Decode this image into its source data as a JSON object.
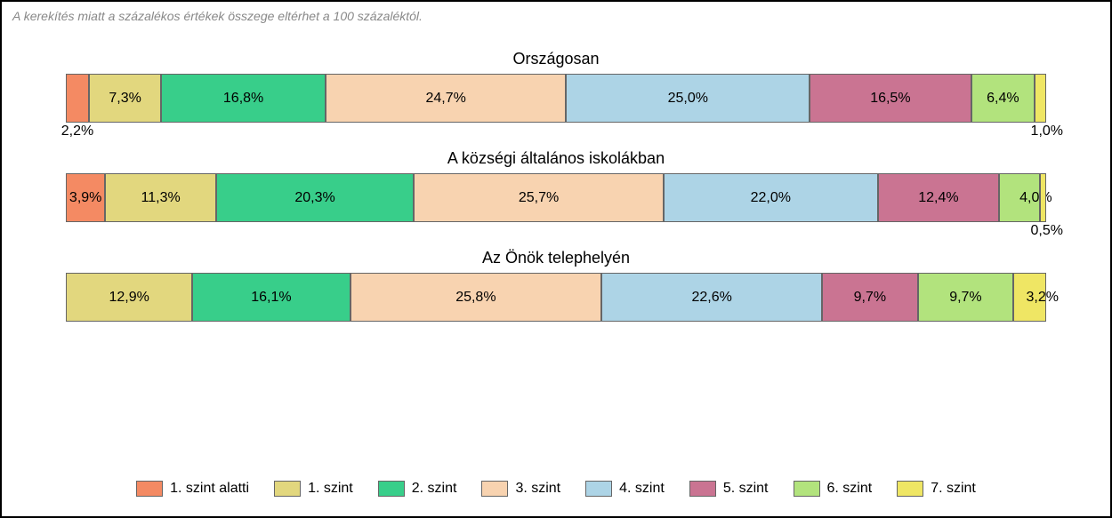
{
  "note": "A kerekítés miatt a százalékos értékek összege eltérhet a 100 százaléktól.",
  "chart_data": {
    "type": "bar",
    "stacked": true,
    "orientation": "horizontal",
    "categories": [
      "Országosan",
      "A községi általános iskolákban",
      "Az Önök telephelyén"
    ],
    "series": [
      {
        "name": "1. szint alatti",
        "color": "#f48a63",
        "values": [
          2.2,
          3.9,
          0.0
        ]
      },
      {
        "name": "1. szint",
        "color": "#e2d77e",
        "values": [
          7.3,
          11.3,
          12.9
        ]
      },
      {
        "name": "2. szint",
        "color": "#38ce8a",
        "values": [
          16.8,
          20.3,
          16.1
        ]
      },
      {
        "name": "3. szint",
        "color": "#f8d3b0",
        "values": [
          24.7,
          25.7,
          25.8
        ]
      },
      {
        "name": "4. szint",
        "color": "#add4e6",
        "values": [
          25.0,
          22.0,
          22.6
        ]
      },
      {
        "name": "5. szint",
        "color": "#ca7492",
        "values": [
          16.5,
          12.4,
          9.7
        ]
      },
      {
        "name": "6. szint",
        "color": "#b2e37d",
        "values": [
          6.4,
          4.0,
          9.7
        ]
      },
      {
        "name": "7. szint",
        "color": "#efe664",
        "values": [
          1.0,
          0.5,
          3.2
        ]
      }
    ]
  },
  "labels": {
    "bar1": {
      "s0": "2,2%",
      "s1": "7,3%",
      "s2": "16,8%",
      "s3": "24,7%",
      "s4": "25,0%",
      "s5": "16,5%",
      "s6": "6,4%",
      "s7": "1,0%"
    },
    "bar2": {
      "s0": "3,9%",
      "s1": "11,3%",
      "s2": "20,3%",
      "s3": "25,7%",
      "s4": "22,0%",
      "s5": "12,4%",
      "s6": "4,0%",
      "s7": "0,5%"
    },
    "bar3": {
      "s1": "12,9%",
      "s2": "16,1%",
      "s3": "25,8%",
      "s4": "22,6%",
      "s5": "9,7%",
      "s6": "9,7%",
      "s7": "3,2%"
    }
  },
  "legend": {
    "l0": "1. szint alatti",
    "l1": "1. szint",
    "l2": "2. szint",
    "l3": "3. szint",
    "l4": "4. szint",
    "l5": "5. szint",
    "l6": "6. szint",
    "l7": "7. szint"
  },
  "titles": {
    "t1": "Országosan",
    "t2": "A községi általános iskolákban",
    "t3": "Az Önök telephelyén"
  }
}
